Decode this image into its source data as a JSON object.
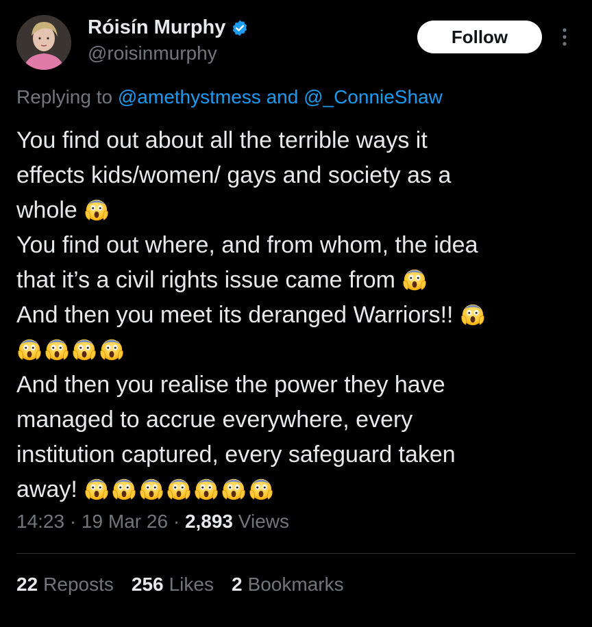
{
  "user": {
    "display_name": "Róisín Murphy",
    "handle": "@roisinmurphy",
    "verified": true,
    "verified_color": "#1d9bf0"
  },
  "follow_button": {
    "label": "Follow"
  },
  "reply": {
    "prefix": "Replying to",
    "mention_1": "@amethystmess",
    "connector": "and",
    "mention_2": "@_ConnieShaw"
  },
  "tweet": {
    "lines": [
      "You find out about all the terrible ways it",
      "effects kids/women/ gays and society as a",
      "whole",
      "You find out where, and from whom, the idea",
      "that it’s a civil rights issue came from",
      "And then you meet its deranged Warriors!!",
      "",
      "And then you realise the power they have",
      "managed to accrue everywhere, every",
      "institution captured, every safeguard taken",
      "away!"
    ],
    "emoji_name": "face-screaming-in-fear"
  },
  "meta": {
    "time": "14:23",
    "separator": "·",
    "date": "19 Mar 26",
    "views_count": "2,893",
    "views_label": "Views"
  },
  "stats": {
    "reposts_count": "22",
    "reposts_label": "Reposts",
    "likes_count": "256",
    "likes_label": "Likes",
    "bookmarks_count": "2",
    "bookmarks_label": "Bookmarks"
  },
  "colors": {
    "background": "#000000",
    "text": "#e7e9ea",
    "secondary": "#71767b",
    "link": "#1d9bf0",
    "divider": "#2f3336"
  }
}
